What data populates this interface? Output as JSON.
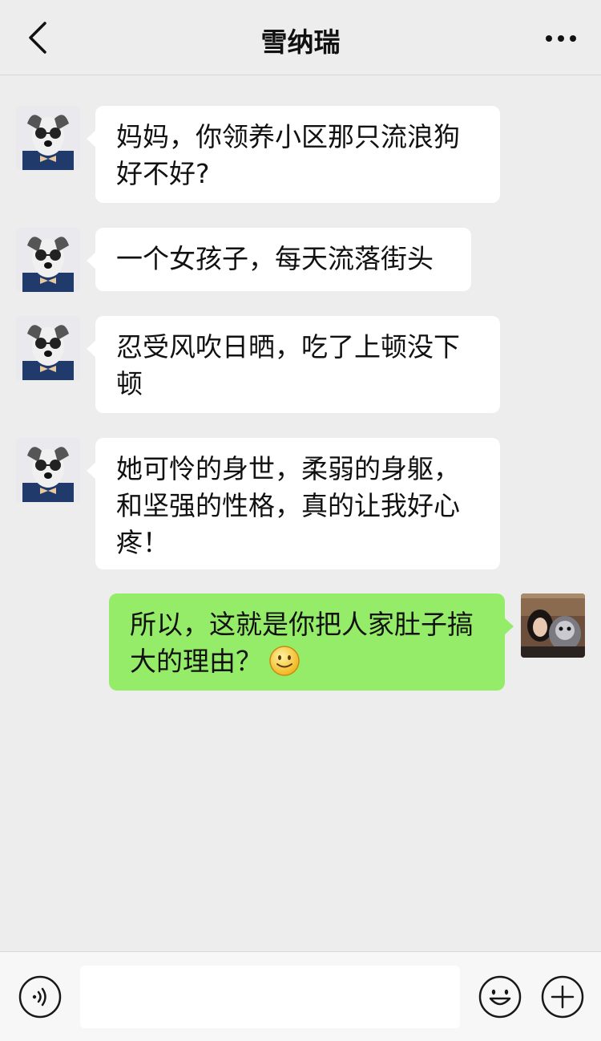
{
  "header": {
    "title": "雪纳瑞",
    "back_icon": "chevron-left-icon",
    "more_icon": "more-dots-icon"
  },
  "messages": [
    {
      "side": "left",
      "lines": [
        "妈妈，你领养小区那只流浪狗",
        "好不好?"
      ]
    },
    {
      "side": "left",
      "lines": [
        "一个女孩子，每天流落街头"
      ]
    },
    {
      "side": "left",
      "lines": [
        "忍受风吹日晒，吃了上顿没下",
        "顿"
      ]
    },
    {
      "side": "left",
      "lines": [
        "她可怜的身世，柔弱的身躯，",
        "和坚强的性格，真的让我好心",
        "疼！"
      ]
    },
    {
      "side": "right",
      "lines": [
        "所以，这就是你把人家肚子搞",
        "大的理由？"
      ],
      "emoji": "smile-emoji"
    }
  ],
  "input_bar": {
    "voice_icon": "voice-icon",
    "emoji_icon": "emoji-face-icon",
    "plus_icon": "plus-circle-icon",
    "input_value": ""
  },
  "colors": {
    "background": "#ededed",
    "bubble_self": "#95ec69",
    "bubble_other": "#ffffff"
  }
}
